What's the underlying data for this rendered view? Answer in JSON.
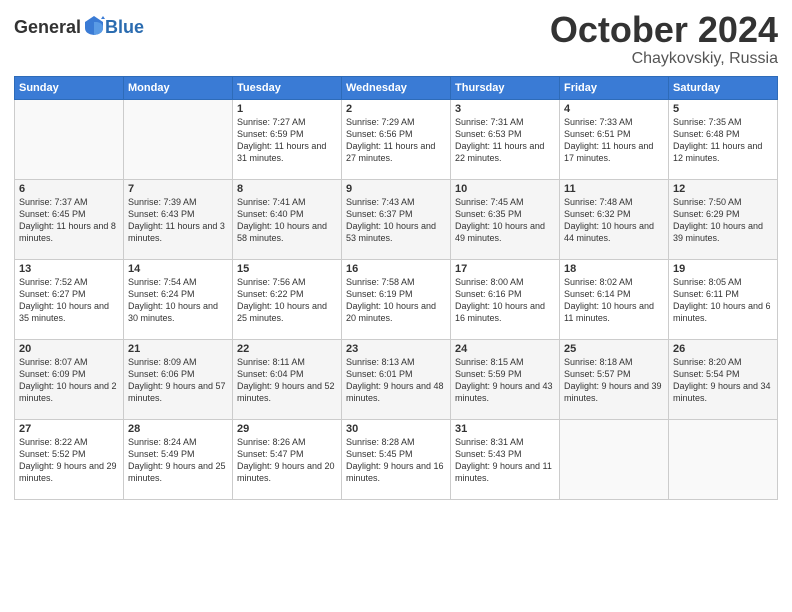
{
  "header": {
    "logo_general": "General",
    "logo_blue": "Blue",
    "month": "October 2024",
    "location": "Chaykovskiy, Russia"
  },
  "days_of_week": [
    "Sunday",
    "Monday",
    "Tuesday",
    "Wednesday",
    "Thursday",
    "Friday",
    "Saturday"
  ],
  "weeks": [
    [
      {
        "day": "",
        "sunrise": "",
        "sunset": "",
        "daylight": ""
      },
      {
        "day": "",
        "sunrise": "",
        "sunset": "",
        "daylight": ""
      },
      {
        "day": "1",
        "sunrise": "Sunrise: 7:27 AM",
        "sunset": "Sunset: 6:59 PM",
        "daylight": "Daylight: 11 hours and 31 minutes."
      },
      {
        "day": "2",
        "sunrise": "Sunrise: 7:29 AM",
        "sunset": "Sunset: 6:56 PM",
        "daylight": "Daylight: 11 hours and 27 minutes."
      },
      {
        "day": "3",
        "sunrise": "Sunrise: 7:31 AM",
        "sunset": "Sunset: 6:53 PM",
        "daylight": "Daylight: 11 hours and 22 minutes."
      },
      {
        "day": "4",
        "sunrise": "Sunrise: 7:33 AM",
        "sunset": "Sunset: 6:51 PM",
        "daylight": "Daylight: 11 hours and 17 minutes."
      },
      {
        "day": "5",
        "sunrise": "Sunrise: 7:35 AM",
        "sunset": "Sunset: 6:48 PM",
        "daylight": "Daylight: 11 hours and 12 minutes."
      }
    ],
    [
      {
        "day": "6",
        "sunrise": "Sunrise: 7:37 AM",
        "sunset": "Sunset: 6:45 PM",
        "daylight": "Daylight: 11 hours and 8 minutes."
      },
      {
        "day": "7",
        "sunrise": "Sunrise: 7:39 AM",
        "sunset": "Sunset: 6:43 PM",
        "daylight": "Daylight: 11 hours and 3 minutes."
      },
      {
        "day": "8",
        "sunrise": "Sunrise: 7:41 AM",
        "sunset": "Sunset: 6:40 PM",
        "daylight": "Daylight: 10 hours and 58 minutes."
      },
      {
        "day": "9",
        "sunrise": "Sunrise: 7:43 AM",
        "sunset": "Sunset: 6:37 PM",
        "daylight": "Daylight: 10 hours and 53 minutes."
      },
      {
        "day": "10",
        "sunrise": "Sunrise: 7:45 AM",
        "sunset": "Sunset: 6:35 PM",
        "daylight": "Daylight: 10 hours and 49 minutes."
      },
      {
        "day": "11",
        "sunrise": "Sunrise: 7:48 AM",
        "sunset": "Sunset: 6:32 PM",
        "daylight": "Daylight: 10 hours and 44 minutes."
      },
      {
        "day": "12",
        "sunrise": "Sunrise: 7:50 AM",
        "sunset": "Sunset: 6:29 PM",
        "daylight": "Daylight: 10 hours and 39 minutes."
      }
    ],
    [
      {
        "day": "13",
        "sunrise": "Sunrise: 7:52 AM",
        "sunset": "Sunset: 6:27 PM",
        "daylight": "Daylight: 10 hours and 35 minutes."
      },
      {
        "day": "14",
        "sunrise": "Sunrise: 7:54 AM",
        "sunset": "Sunset: 6:24 PM",
        "daylight": "Daylight: 10 hours and 30 minutes."
      },
      {
        "day": "15",
        "sunrise": "Sunrise: 7:56 AM",
        "sunset": "Sunset: 6:22 PM",
        "daylight": "Daylight: 10 hours and 25 minutes."
      },
      {
        "day": "16",
        "sunrise": "Sunrise: 7:58 AM",
        "sunset": "Sunset: 6:19 PM",
        "daylight": "Daylight: 10 hours and 20 minutes."
      },
      {
        "day": "17",
        "sunrise": "Sunrise: 8:00 AM",
        "sunset": "Sunset: 6:16 PM",
        "daylight": "Daylight: 10 hours and 16 minutes."
      },
      {
        "day": "18",
        "sunrise": "Sunrise: 8:02 AM",
        "sunset": "Sunset: 6:14 PM",
        "daylight": "Daylight: 10 hours and 11 minutes."
      },
      {
        "day": "19",
        "sunrise": "Sunrise: 8:05 AM",
        "sunset": "Sunset: 6:11 PM",
        "daylight": "Daylight: 10 hours and 6 minutes."
      }
    ],
    [
      {
        "day": "20",
        "sunrise": "Sunrise: 8:07 AM",
        "sunset": "Sunset: 6:09 PM",
        "daylight": "Daylight: 10 hours and 2 minutes."
      },
      {
        "day": "21",
        "sunrise": "Sunrise: 8:09 AM",
        "sunset": "Sunset: 6:06 PM",
        "daylight": "Daylight: 9 hours and 57 minutes."
      },
      {
        "day": "22",
        "sunrise": "Sunrise: 8:11 AM",
        "sunset": "Sunset: 6:04 PM",
        "daylight": "Daylight: 9 hours and 52 minutes."
      },
      {
        "day": "23",
        "sunrise": "Sunrise: 8:13 AM",
        "sunset": "Sunset: 6:01 PM",
        "daylight": "Daylight: 9 hours and 48 minutes."
      },
      {
        "day": "24",
        "sunrise": "Sunrise: 8:15 AM",
        "sunset": "Sunset: 5:59 PM",
        "daylight": "Daylight: 9 hours and 43 minutes."
      },
      {
        "day": "25",
        "sunrise": "Sunrise: 8:18 AM",
        "sunset": "Sunset: 5:57 PM",
        "daylight": "Daylight: 9 hours and 39 minutes."
      },
      {
        "day": "26",
        "sunrise": "Sunrise: 8:20 AM",
        "sunset": "Sunset: 5:54 PM",
        "daylight": "Daylight: 9 hours and 34 minutes."
      }
    ],
    [
      {
        "day": "27",
        "sunrise": "Sunrise: 8:22 AM",
        "sunset": "Sunset: 5:52 PM",
        "daylight": "Daylight: 9 hours and 29 minutes."
      },
      {
        "day": "28",
        "sunrise": "Sunrise: 8:24 AM",
        "sunset": "Sunset: 5:49 PM",
        "daylight": "Daylight: 9 hours and 25 minutes."
      },
      {
        "day": "29",
        "sunrise": "Sunrise: 8:26 AM",
        "sunset": "Sunset: 5:47 PM",
        "daylight": "Daylight: 9 hours and 20 minutes."
      },
      {
        "day": "30",
        "sunrise": "Sunrise: 8:28 AM",
        "sunset": "Sunset: 5:45 PM",
        "daylight": "Daylight: 9 hours and 16 minutes."
      },
      {
        "day": "31",
        "sunrise": "Sunrise: 8:31 AM",
        "sunset": "Sunset: 5:43 PM",
        "daylight": "Daylight: 9 hours and 11 minutes."
      },
      {
        "day": "",
        "sunrise": "",
        "sunset": "",
        "daylight": ""
      },
      {
        "day": "",
        "sunrise": "",
        "sunset": "",
        "daylight": ""
      }
    ]
  ]
}
